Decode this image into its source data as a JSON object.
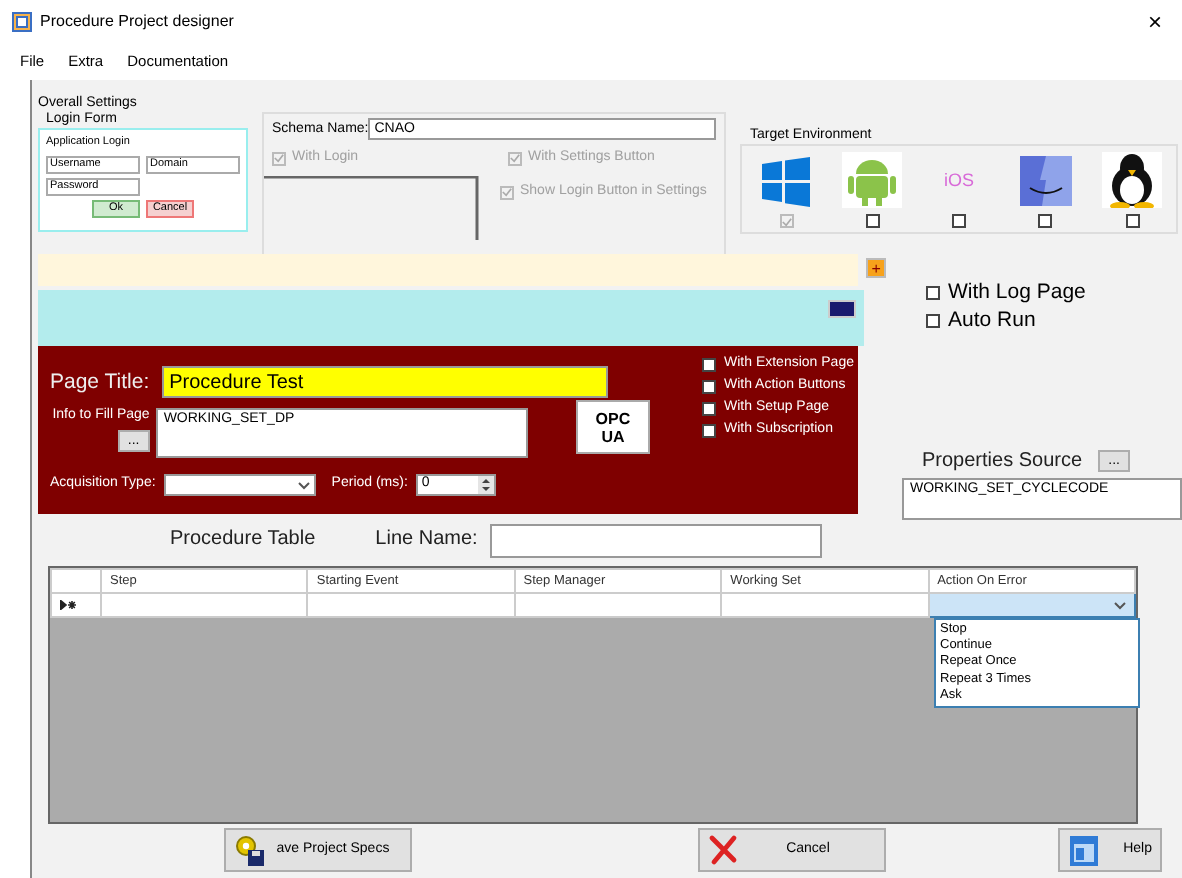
{
  "window": {
    "title": "Procedure Project designer",
    "close": "×"
  },
  "menu": [
    "File",
    "Extra",
    "Documentation"
  ],
  "overall_settings": {
    "label": "Overall Settings",
    "login_form": {
      "label": "Login Form",
      "preview": {
        "title": "Application Login",
        "fields": [
          "Username",
          "Domain",
          "Password"
        ],
        "buttons": [
          "Ok",
          "Cancel"
        ]
      }
    },
    "schema_name": {
      "label": "Schema Name:",
      "value": "CNAO"
    },
    "options": [
      {
        "label": "With Login",
        "checked": true,
        "disabled": true
      },
      {
        "label": "With Settings Button",
        "checked": true,
        "disabled": true
      },
      {
        "label": "Show Login Button in Settings",
        "checked": true,
        "disabled": true
      }
    ]
  },
  "target_environment": {
    "label": "Target Environment",
    "platforms": [
      {
        "kind": "windows",
        "checked": true,
        "disabled": true
      },
      {
        "kind": "android",
        "checked": false,
        "disabled": false
      },
      {
        "kind": "ios",
        "label": "iOS",
        "checked": false,
        "disabled": false
      },
      {
        "kind": "mac",
        "checked": false,
        "disabled": false
      },
      {
        "kind": "linux",
        "checked": false,
        "disabled": false
      }
    ]
  },
  "add_button": "+",
  "log_options": [
    {
      "label": "With Log Page",
      "checked": false
    },
    {
      "label": "Auto Run",
      "checked": false
    }
  ],
  "page_panel": {
    "page_title": {
      "label": "Page Title:",
      "value": "Procedure Test"
    },
    "info": {
      "label": "Info to Fill Page",
      "button": "...",
      "value": "WORKING_SET_DP"
    },
    "logo_lines": [
      "OPC",
      "UA"
    ],
    "options": [
      {
        "label": "With Extension Page",
        "checked": false
      },
      {
        "label": "With Action Buttons",
        "checked": false
      },
      {
        "label": "With Setup Page",
        "checked": false
      },
      {
        "label": "With Subscription",
        "checked": false
      }
    ],
    "acquisition_type": {
      "label": "Acquisition Type:"
    },
    "period": {
      "label": "Period (ms):",
      "value": "0"
    }
  },
  "properties_source": {
    "label": "Properties Source",
    "button": "...",
    "value": "WORKING_SET_CYCLECODE"
  },
  "procedure_table": {
    "label": "Procedure Table",
    "line_name": {
      "label": "Line Name:"
    },
    "columns": [
      "Step",
      "Starting Event",
      "Step Manager",
      "Working Set",
      "Action On Error"
    ],
    "dropdown": [
      {
        "label": "Stop",
        "selected": false
      },
      {
        "label": "Continue",
        "selected": false
      },
      {
        "label": "Repeat Once",
        "selected": false
      },
      {
        "label": "Repeat 3 Times",
        "selected": false
      },
      {
        "label": "Ask",
        "selected": false
      }
    ]
  },
  "buttons": [
    {
      "kind": "save",
      "label": "ave Project Specs"
    },
    {
      "kind": "cancel",
      "label": "Cancel"
    },
    {
      "kind": "help",
      "label": "Help"
    }
  ]
}
